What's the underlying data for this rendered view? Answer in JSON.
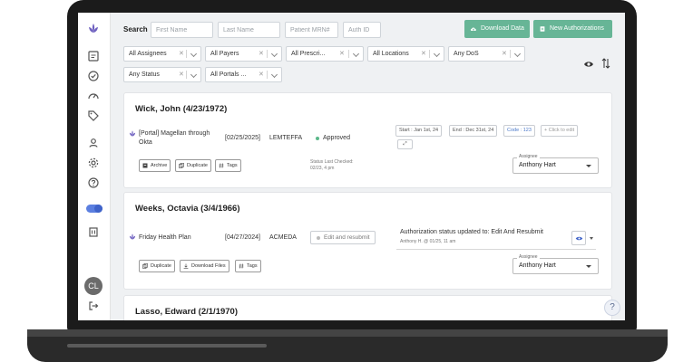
{
  "sidebar": {
    "logo": "lotus-icon",
    "icons": [
      "clipboard-icon",
      "check-circle-icon",
      "gauge-icon",
      "tag-icon",
      "user-icon",
      "gear-icon",
      "help-circle-icon",
      "toggle-icon",
      "building-icon",
      "logout-icon"
    ],
    "avatar_initials": "CL"
  },
  "search": {
    "label": "Search",
    "first_name_placeholder": "First Name",
    "last_name_placeholder": "Last Name",
    "mrn_placeholder": "Patient MRN#",
    "auth_id_placeholder": "Auth ID"
  },
  "actions": {
    "download_label": "Download Data",
    "new_auth_label": "New Authorizations"
  },
  "filters": {
    "assignees": "All Assignees",
    "payers": "All Payers",
    "prescribers": "All Prescri...",
    "locations": "All Locations",
    "dos": "Any DoS",
    "status": "Any Status",
    "portals": "All Portals ..."
  },
  "cards": [
    {
      "patient": "Wick, John (4/23/1972)",
      "portal": "[Portal] Magellan through",
      "portal_line2": "Okta",
      "date": "[02/25/2025]",
      "code": "LEMTEFFA",
      "status": "Approved",
      "status_color": "#5bb88a",
      "status_checked_label": "Status Last Checked:",
      "status_checked_value": "02/23, 4 pm",
      "chips": {
        "start": "Start : Jan 1st, 24",
        "end": "End : Dec 31st, 24",
        "code": "Code : 123",
        "edit": "+ Click to edit"
      },
      "buttons": {
        "archive": "Archive",
        "duplicate": "Duplicate",
        "tags": "Tags"
      },
      "assignee_label": "Assignee",
      "assignee": "Anthony Hart"
    },
    {
      "patient": "Weeks, Octavia (3/4/1966)",
      "portal": "Friday Health Plan",
      "date": "[04/27/2024]",
      "code": "ACMEDA",
      "edit_resubmit": "Edit and resubmit",
      "update_text": "Authorization status updated to: Edit And Resubmit",
      "update_meta": "Anthony H. @ 01/25, 11 am",
      "buttons": {
        "duplicate": "Duplicate",
        "download": "Download Files",
        "tags": "Tags"
      },
      "assignee_label": "Assignee",
      "assignee": "Anthony Hart"
    },
    {
      "patient": "Lasso, Edward (2/1/1970)"
    }
  ],
  "help_label": "?",
  "colors": {
    "accent_green": "#67b596",
    "toggle_blue": "#5b7fe0",
    "approved": "#5bb88a",
    "frame": "#1b1b1b"
  }
}
